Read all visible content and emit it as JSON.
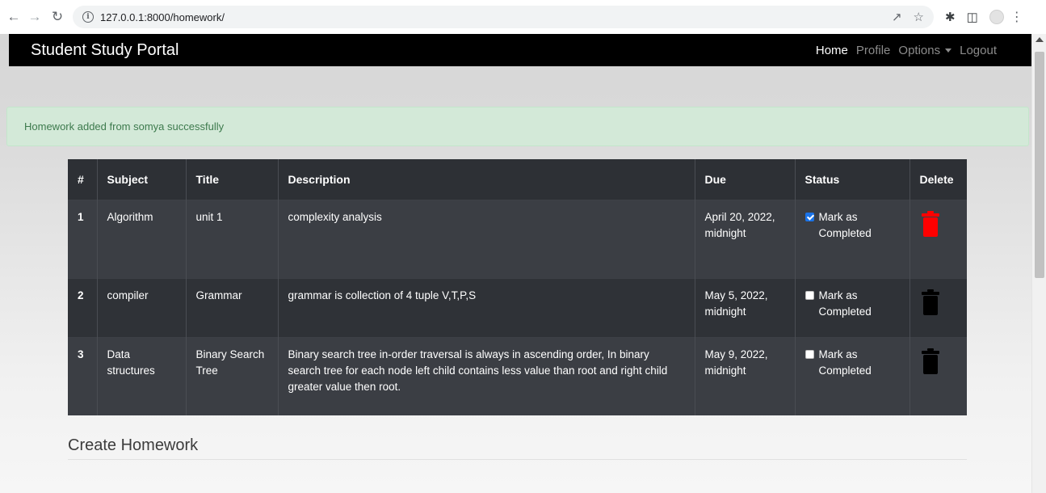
{
  "browser": {
    "url": "127.0.0.1:8000/homework/"
  },
  "navbar": {
    "brand": "Student Study Portal",
    "links": [
      "Home",
      "Profile",
      "Options",
      "Logout"
    ]
  },
  "alert": {
    "message": "Homework added from somya successfully",
    "color": "#d3e9d8"
  },
  "table": {
    "headers": [
      "#",
      "Subject",
      "Title",
      "Description",
      "Due",
      "Status",
      "Delete"
    ],
    "rows": [
      {
        "num": "1",
        "subject": "Algorithm",
        "title": "unit 1",
        "description": "complexity analysis",
        "due": "April 20, 2022, midnight",
        "status_label": "Mark as Completed",
        "completed": true,
        "delete_color": "#ff0000"
      },
      {
        "num": "2",
        "subject": "compiler",
        "title": "Grammar",
        "description": "grammar is collection of 4 tuple V,T,P,S",
        "due": "May 5, 2022, midnight",
        "status_label": "Mark as Completed",
        "completed": false,
        "delete_color": "#000000"
      },
      {
        "num": "3",
        "subject": "Data structures",
        "title": "Binary Search Tree",
        "description": "Binary search tree in-order traversal is always in ascending order, In binary search tree for each node left child contains less value than root and right child greater value then root.",
        "due": "May 9, 2022, midnight",
        "status_label": "Mark as Completed",
        "completed": false,
        "delete_color": "#000000"
      }
    ]
  },
  "create_section": {
    "title": "Create Homework"
  }
}
